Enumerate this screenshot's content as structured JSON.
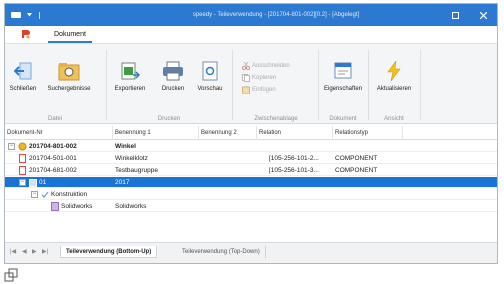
{
  "window": {
    "title": "speedy - Teileverwendung - [201704-801-002][0.2] - [Abgelegt]",
    "colors": {
      "titlebar": "#2b79d0",
      "selection": "#1a73d6",
      "logo": "#d9432c"
    }
  },
  "tabs": {
    "logo": "ᴮ",
    "document": "Dokument"
  },
  "ribbon": {
    "groups": [
      {
        "label": "Datei",
        "buttons": [
          "Schließen",
          "Suchergebnisse"
        ]
      },
      {
        "label": "Drucken",
        "buttons": [
          "Exportieren",
          "Drucken",
          "Vorschau"
        ]
      },
      {
        "label": "Zwischenablage",
        "items": [
          "Ausschneiden",
          "Kopieren",
          "Einfügen"
        ]
      },
      {
        "label": "Dokument",
        "buttons": [
          "Eigenschaften"
        ]
      },
      {
        "label": "Ansicht",
        "buttons": [
          "Aktualisieren"
        ]
      }
    ]
  },
  "grid": {
    "columns": [
      "Dokument-Nr",
      "Benennung 1",
      "Benennung 2",
      "Relation",
      "Relationstyp"
    ],
    "rows": [
      {
        "cells": [
          "201704-801-002",
          "Winkel",
          "",
          "",
          ""
        ],
        "bold": true
      },
      {
        "cells": [
          "201704-501-001",
          "Winkelklotz",
          "",
          "[105-256-101-2...",
          "COMPONENT"
        ]
      },
      {
        "cells": [
          "201704-681-002",
          "Testbaugruppe",
          "",
          "[105-256-101-3...",
          "COMPONENT"
        ]
      },
      {
        "cells": [
          "01",
          "2017",
          "",
          "",
          ""
        ],
        "selected": true
      },
      {
        "cells": [
          "Konstruktion",
          "",
          "",
          "",
          ""
        ]
      },
      {
        "cells": [
          "Solidworks",
          "Solidworks",
          "",
          "",
          ""
        ]
      }
    ]
  },
  "sheets": {
    "nav": [
      "|◀",
      "◀",
      "▶",
      "▶|"
    ],
    "tab1": "Teileverwendung (Bottom-Up)",
    "tab2": "Teileverwendung (Top-Down)"
  }
}
